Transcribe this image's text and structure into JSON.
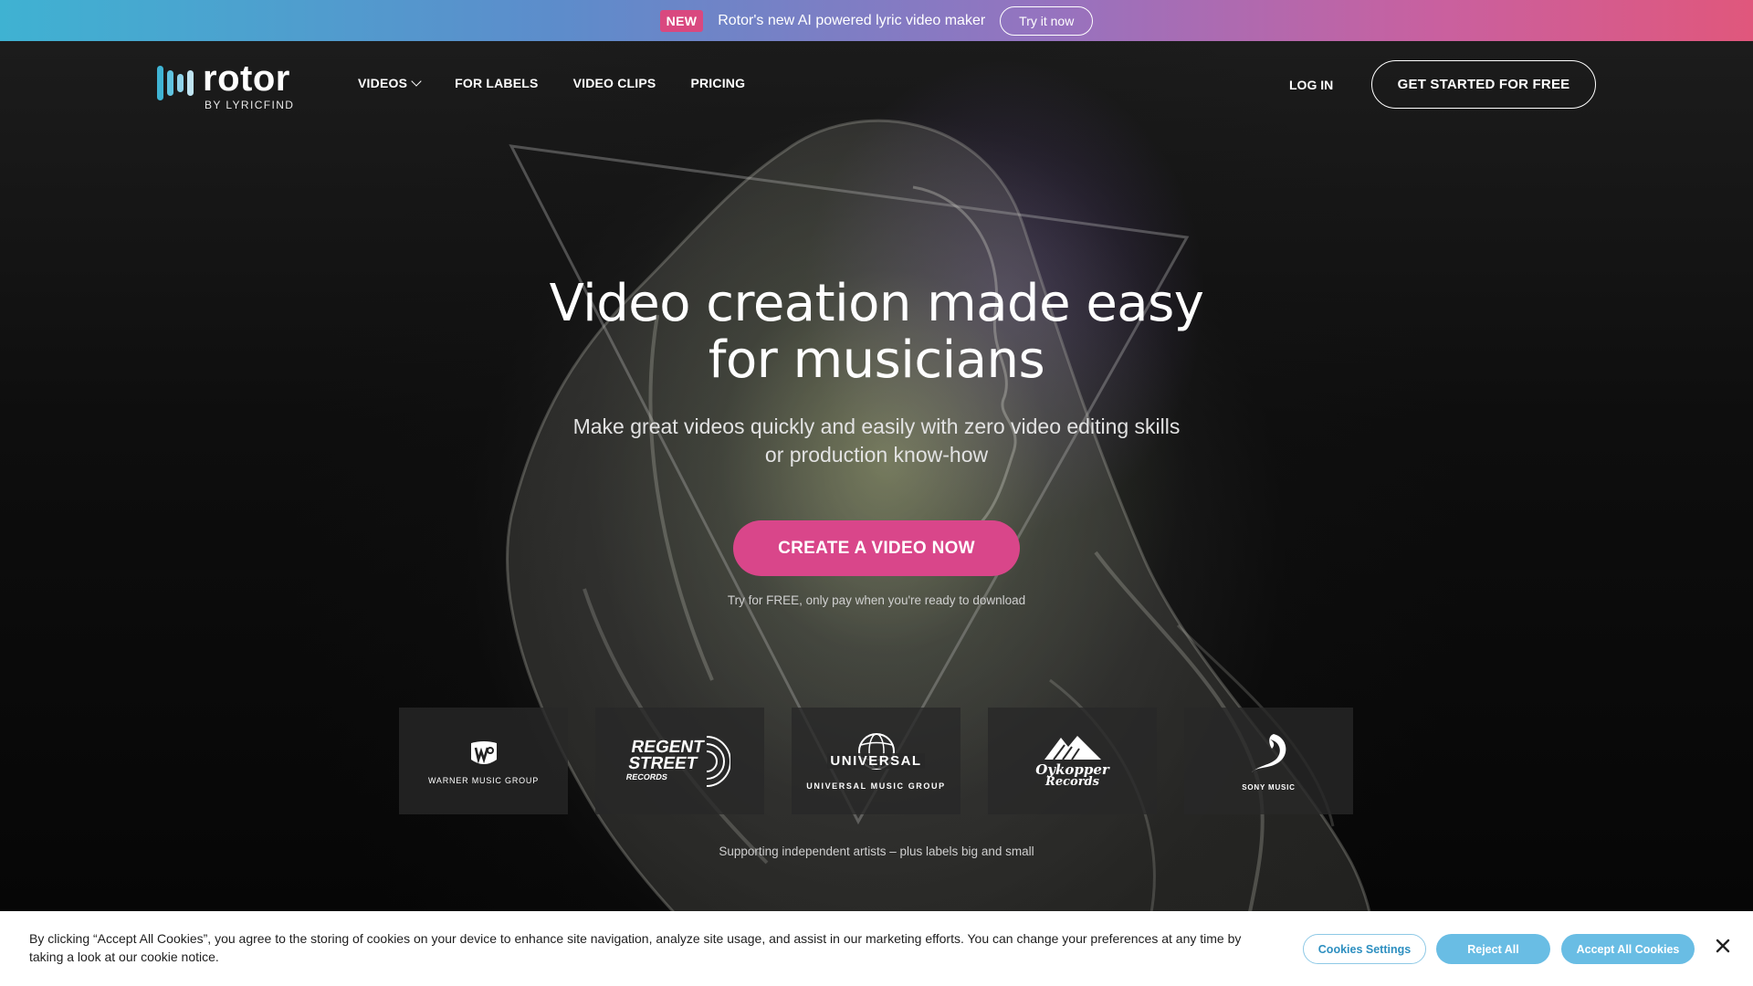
{
  "announcement": {
    "badge": "NEW",
    "text": "Rotor's new AI powered lyric video maker",
    "button": "Try it now"
  },
  "header": {
    "logo": {
      "name": "rotor",
      "sub": "BY LYRICFIND",
      "bar_colors": [
        "#3fb4d4",
        "#5fc3e0",
        "#8fd3ea",
        "#bfe4f2"
      ]
    },
    "nav": [
      {
        "label": "VIDEOS",
        "has_dropdown": true
      },
      {
        "label": "FOR LABELS"
      },
      {
        "label": "VIDEO CLIPS"
      },
      {
        "label": "PRICING"
      }
    ],
    "login": "LOG IN",
    "cta": "GET STARTED FOR FREE"
  },
  "hero": {
    "title_line1": "Video creation made easy",
    "title_line2": "for musicians",
    "subtitle_line1": "Make great videos quickly and easily with zero video editing skills",
    "subtitle_line2": "or production know-how",
    "button": "CREATE A VIDEO NOW",
    "note": "Try for FREE, only pay when you're ready to download"
  },
  "labels": {
    "items": [
      {
        "name": "WARNER MUSIC GROUP",
        "icon": "warner-logo"
      },
      {
        "name": "REGENT STREET RECORDS",
        "icon": "regent-street-logo"
      },
      {
        "name": "UNIVERSAL MUSIC GROUP",
        "icon": "universal-logo"
      },
      {
        "name": "Oykopper Records",
        "icon": "oykopper-logo"
      },
      {
        "name": "SONY MUSIC",
        "icon": "sony-logo"
      }
    ],
    "universal_word": "UNIVERSAL",
    "regent_lines": [
      "REGENT",
      "STREET",
      "RECORDS"
    ],
    "oykopper_lines": [
      "Oykopper",
      "Records"
    ],
    "support_note": "Supporting independent artists – plus labels big and small"
  },
  "cookie": {
    "text": "By clicking “Accept All Cookies”, you agree to the storing of cookies on your device to enhance site navigation, analyze site usage, and assist in our marketing efforts. You can change your preferences at any time by taking a look at our cookie notice.",
    "settings": "Cookies Settings",
    "reject": "Reject All",
    "accept": "Accept All Cookies"
  },
  "colors": {
    "accent_pink": "#d9468a",
    "cookie_blue": "#69bde4"
  }
}
